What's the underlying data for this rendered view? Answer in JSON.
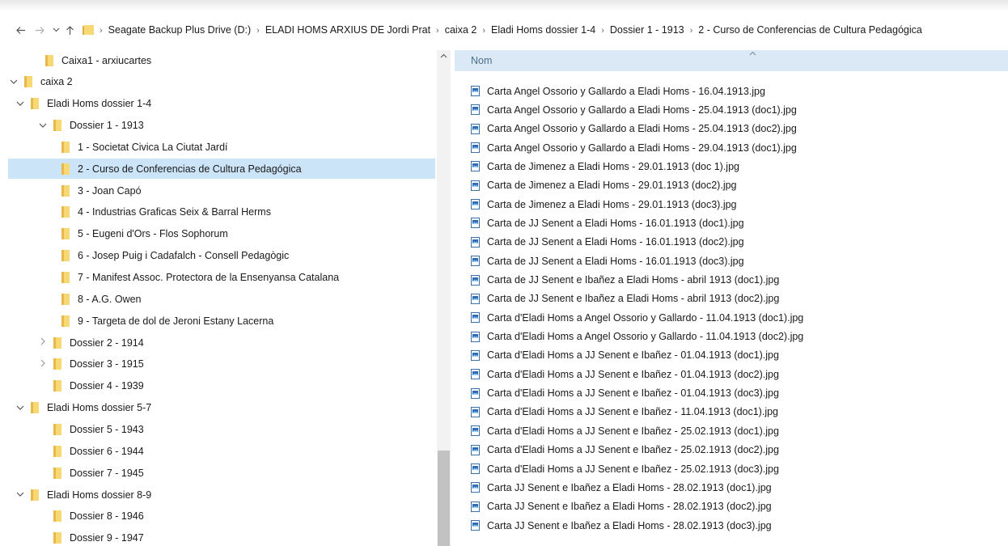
{
  "colors": {
    "selection": "#cce4f7",
    "header": "#dbe9f6",
    "folder": "#f8d775"
  },
  "addressbar": {
    "back_icon": "arrow-left-icon",
    "forward_icon": "arrow-right-icon",
    "recent_icon": "chevron-down-icon",
    "up_icon": "arrow-up-icon",
    "breadcrumbs": [
      "Seagate Backup Plus Drive (D:)",
      "ELADI HOMS ARXIUS DE Jordi Prat",
      "caixa 2",
      "Eladi Homs dossier 1-4",
      "Dossier 1 - 1913",
      "2 - Curso de Conferencias de Cultura Pedagógica"
    ]
  },
  "tree": [
    {
      "label": "Caixa1 - arxiucartes",
      "chevron": ""
    },
    {
      "label": "caixa 2",
      "chevron": "expanded"
    },
    {
      "label": "Eladi Homs dossier 1-4",
      "chevron": "expanded"
    },
    {
      "label": "Dossier 1 - 1913",
      "chevron": "expanded"
    },
    {
      "label": "1 - Societat Civica La Ciutat Jardí",
      "chevron": ""
    },
    {
      "label": "2 - Curso de Conferencias de Cultura Pedagógica",
      "chevron": "",
      "selected": true
    },
    {
      "label": "3 - Joan Capó",
      "chevron": ""
    },
    {
      "label": "4 - Industrias Graficas Seix & Barral Herms",
      "chevron": ""
    },
    {
      "label": "5 - Eugeni d'Ors - Flos Sophorum",
      "chevron": ""
    },
    {
      "label": "6 - Josep Puig i Cadafalch - Consell Pedagògic",
      "chevron": ""
    },
    {
      "label": "7 - Manifest Assoc. Protectora de la Ensenyansa Catalana",
      "chevron": ""
    },
    {
      "label": "8 - A.G. Owen",
      "chevron": ""
    },
    {
      "label": "9 - Targeta de dol de Jeroni Estany Lacerna",
      "chevron": ""
    },
    {
      "label": "Dossier 2 - 1914",
      "chevron": "collapsed"
    },
    {
      "label": "Dossier 3 - 1915",
      "chevron": "collapsed"
    },
    {
      "label": "Dossier 4 - 1939",
      "chevron": ""
    },
    {
      "label": "Eladi Homs dossier 5-7",
      "chevron": "expanded"
    },
    {
      "label": "Dossier 5 - 1943",
      "chevron": ""
    },
    {
      "label": "Dossier 6 - 1944",
      "chevron": ""
    },
    {
      "label": "Dossier 7 - 1945",
      "chevron": ""
    },
    {
      "label": "Eladi Homs dossier 8-9",
      "chevron": "expanded"
    },
    {
      "label": "Dossier 8 - 1946",
      "chevron": ""
    },
    {
      "label": "Dossier 9 - 1947",
      "chevron": ""
    }
  ],
  "file_list": {
    "column_header": "Nom",
    "files": [
      "Carta Angel Ossorio y  Gallardo a Eladi Homs - 16.04.1913.jpg",
      "Carta Angel Ossorio y  Gallardo a Eladi Homs - 25.04.1913 (doc1).jpg",
      "Carta Angel Ossorio y  Gallardo a Eladi Homs - 25.04.1913 (doc2).jpg",
      "Carta Angel Ossorio y  Gallardo a Eladi Homs - 29.04.1913 (doc1).jpg",
      "Carta de Jimenez a Eladi Homs - 29.01.1913 (doc 1).jpg",
      "Carta de Jimenez a Eladi Homs - 29.01.1913 (doc2).jpg",
      "Carta de Jimenez a Eladi Homs - 29.01.1913 (doc3).jpg",
      "Carta de JJ Senent a Eladi Homs - 16.01.1913 (doc1).jpg",
      "Carta de JJ Senent a Eladi Homs - 16.01.1913 (doc2).jpg",
      "Carta de JJ Senent a Eladi Homs - 16.01.1913 (doc3).jpg",
      "Carta de JJ Senent e Ibañez a Eladi Homs - abril 1913 (doc1).jpg",
      "Carta de JJ Senent e Ibañez a Eladi Homs - abril 1913 (doc2).jpg",
      "Carta d'Eladi Homs a Angel Ossorio y Gallardo - 11.04.1913 (doc1).jpg",
      "Carta d'Eladi Homs a Angel Ossorio y Gallardo - 11.04.1913 (doc2).jpg",
      "Carta d'Eladi Homs a JJ Senent e Ibañez - 01.04.1913 (doc1).jpg",
      "Carta d'Eladi Homs a JJ Senent e Ibañez - 01.04.1913 (doc2).jpg",
      "Carta d'Eladi Homs a JJ Senent e Ibañez - 01.04.1913 (doc3).jpg",
      "Carta d'Eladi Homs a JJ Senent e Ibañez - 11.04.1913 (doc1).jpg",
      "Carta d'Eladi Homs a JJ Senent e Ibañez - 25.02.1913 (doc1).jpg",
      "Carta d'Eladi Homs a JJ Senent e Ibañez - 25.02.1913 (doc2).jpg",
      "Carta d'Eladi Homs a JJ Senent e Ibañez - 25.02.1913 (doc3).jpg",
      "Carta JJ Senent e Ibañez a Eladi Homs - 28.02.1913 (doc1).jpg",
      "Carta JJ Senent e Ibañez a Eladi Homs - 28.02.1913 (doc2).jpg",
      "Carta JJ Senent e Ibañez a Eladi Homs - 28.02.1913 (doc3).jpg"
    ]
  }
}
